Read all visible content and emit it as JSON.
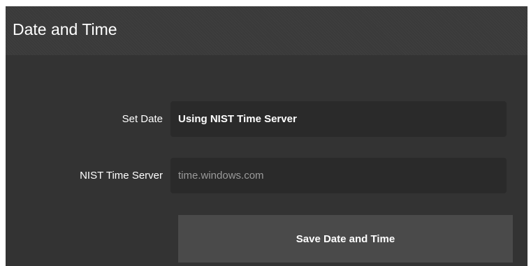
{
  "panel": {
    "title": "Date and Time"
  },
  "form": {
    "set_date": {
      "label": "Set Date",
      "value": "Using NIST Time Server"
    },
    "nist_server": {
      "label": "NIST Time Server",
      "placeholder": "time.windows.com",
      "value": ""
    },
    "save_label": "Save Date and Time"
  },
  "colors": {
    "panel_background": "#333333",
    "header_background": "#3a3a3a",
    "field_background": "#2a2a2a",
    "button_background": "#4a4a4a",
    "text": "#ffffff"
  }
}
